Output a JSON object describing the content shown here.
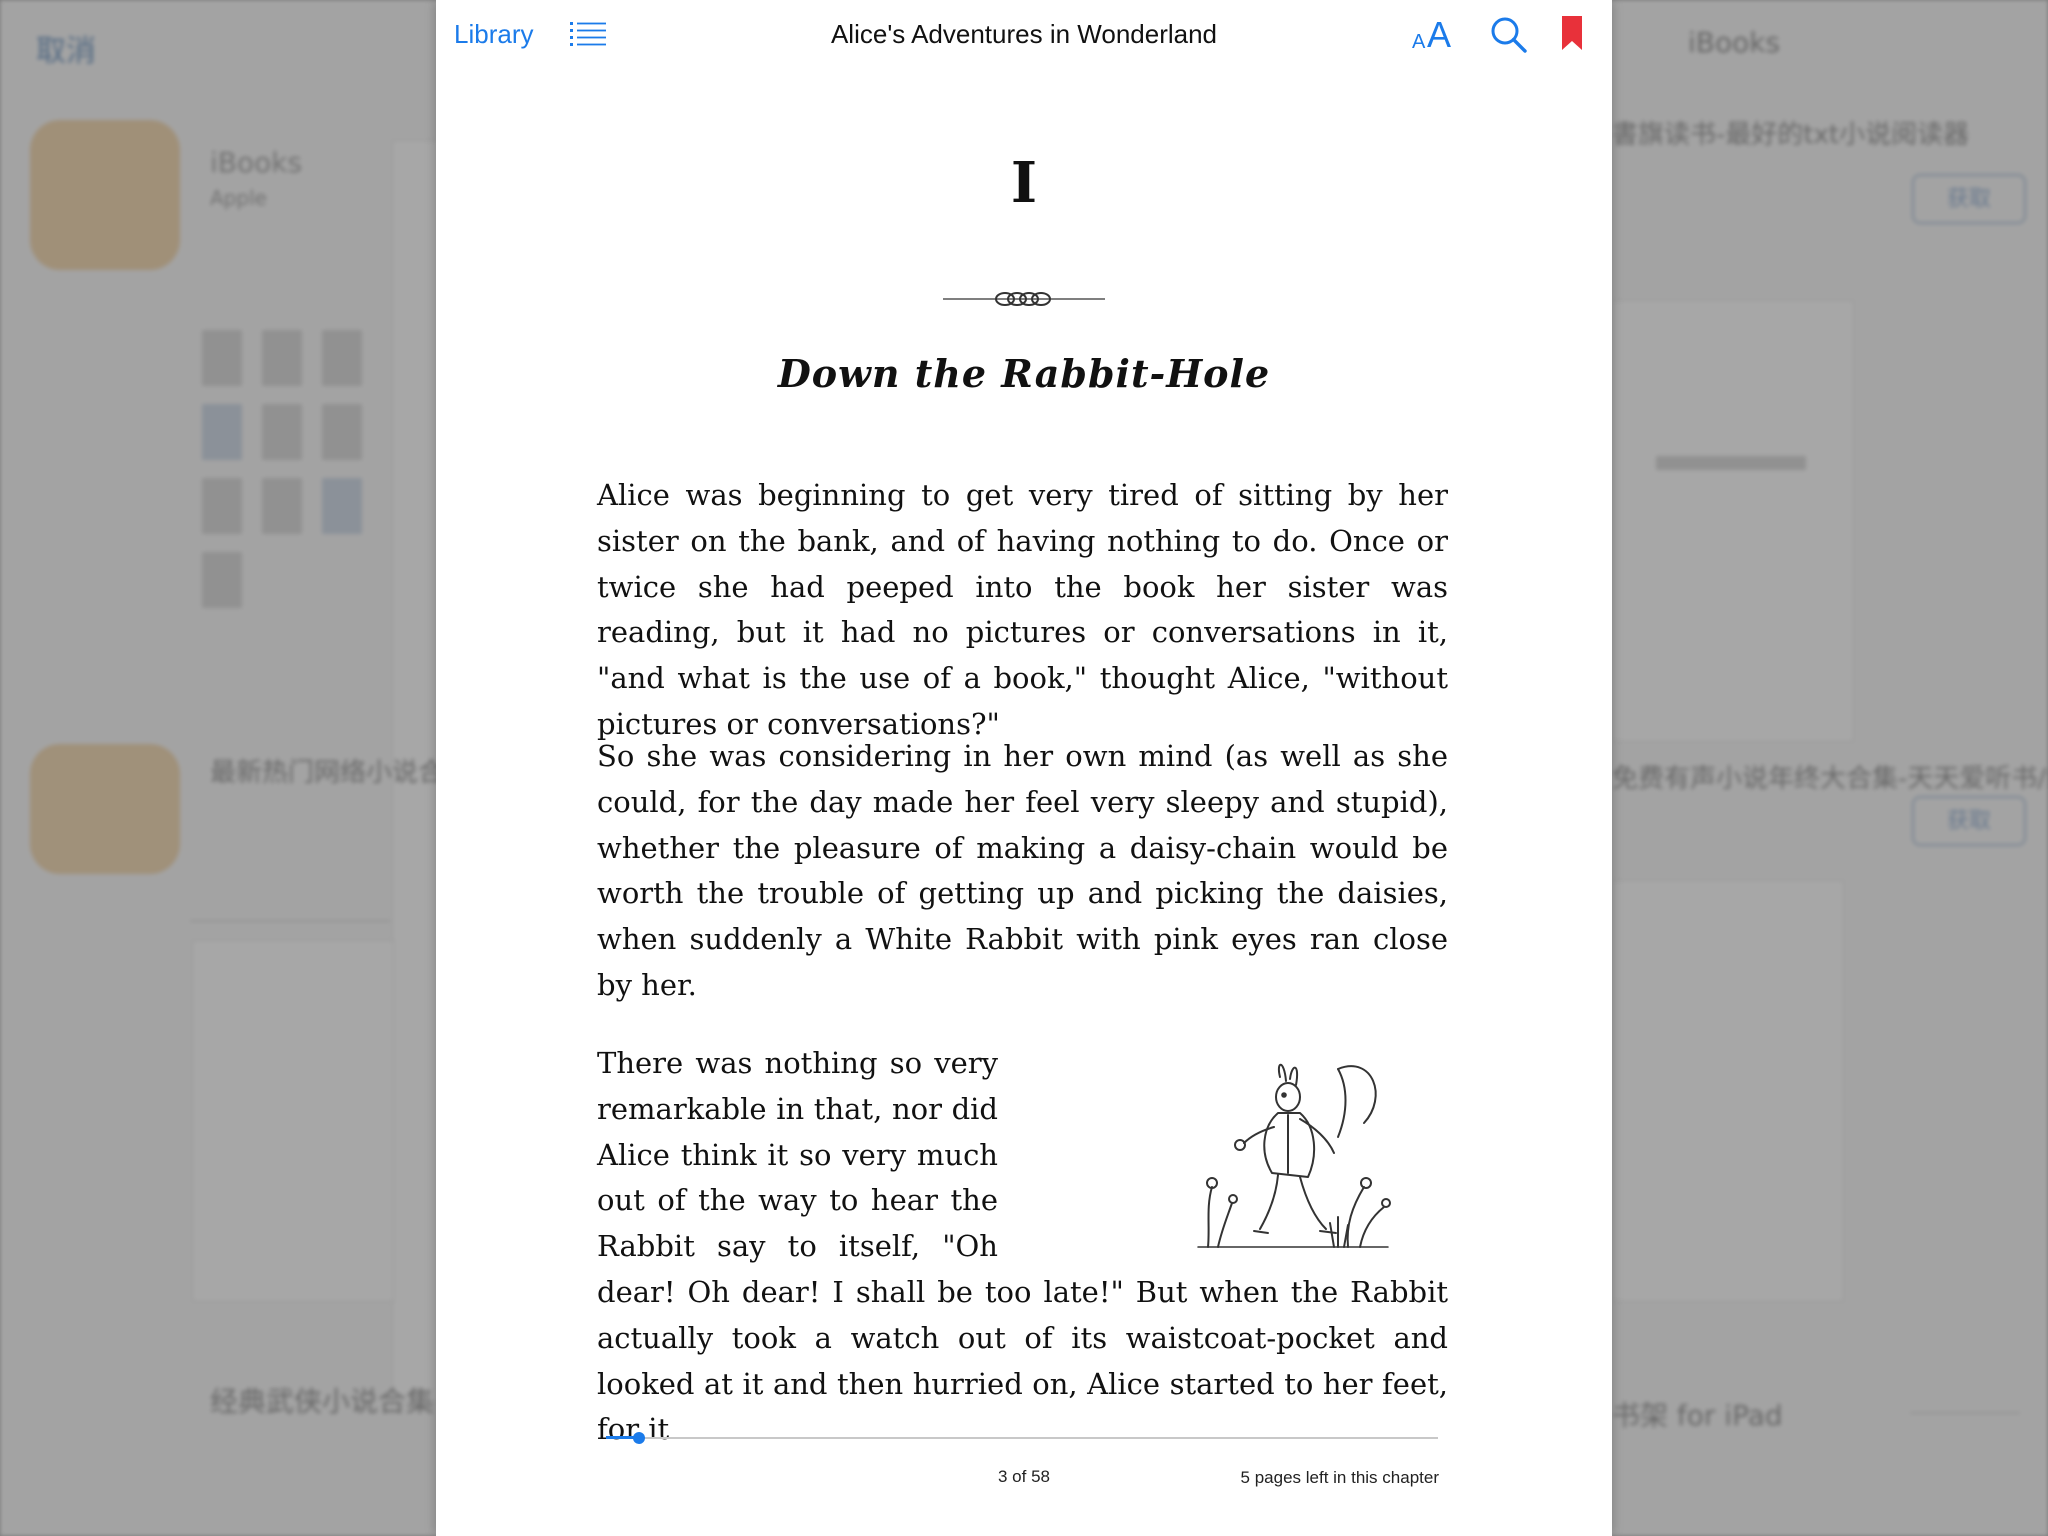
{
  "background_app": {
    "cancel_label": "取消",
    "store_label": "iBooks",
    "app_name": "iBooks",
    "app_developer": "Apple",
    "right_app_title": "書旗读书-最好的txt小说阅读器",
    "right_app_title2": "免费有声小说年终大合集-天天爱听书/绝…",
    "left_app_title": "最新热门网络小说合集",
    "bottom_app_title": "经典武侠小说合集",
    "bottom_right_title": "书架 for iPad",
    "get_label": "获取"
  },
  "reader": {
    "toolbar": {
      "library_label": "Library",
      "book_title": "Alice's Adventures in Wonderland",
      "font_small": "A",
      "font_large": "A"
    },
    "chapter": {
      "number": "I",
      "title": "Down the Rabbit-Hole"
    },
    "paragraphs": [
      "Alice was beginning to get very tired of sitting by her sister on the bank, and of having nothing to do. Once or twice she had peeped into the book her sister was reading, but it had no pictures or conversations in it, \"and what is the use of a book,\" thought Alice, \"without pictures or conversations?\"",
      "So she was considering in her own mind (as well as she could, for the day made her feel very sleepy and stupid), whether the pleasure of making a daisy-chain would be worth the trouble of getting up and picking the daisies, when suddenly a White Rabbit with pink eyes ran close by her.",
      "There was nothing so very remarkable in that, nor did Alice think it so very much out of the way to hear the Rabbit say to itself, \"Oh dear! Oh dear! I shall be too late!\" But when the Rabbit actually took a watch out of its waistcoat-pocket and looked at it and then hurried on, Alice started to her feet, for it"
    ],
    "footer": {
      "page_indicator": "3 of 58",
      "pages_left": "5 pages left in this chapter",
      "progress_fraction": 0.04
    },
    "colors": {
      "accent": "#1b7bea",
      "bookmark": "#e8313a"
    },
    "icons": {
      "toc": "list-icon",
      "search": "search-icon",
      "bookmark": "bookmark-icon",
      "font": "font-size-icon",
      "ornament": "ornament-divider",
      "illustration": "white-rabbit-illustration"
    }
  }
}
